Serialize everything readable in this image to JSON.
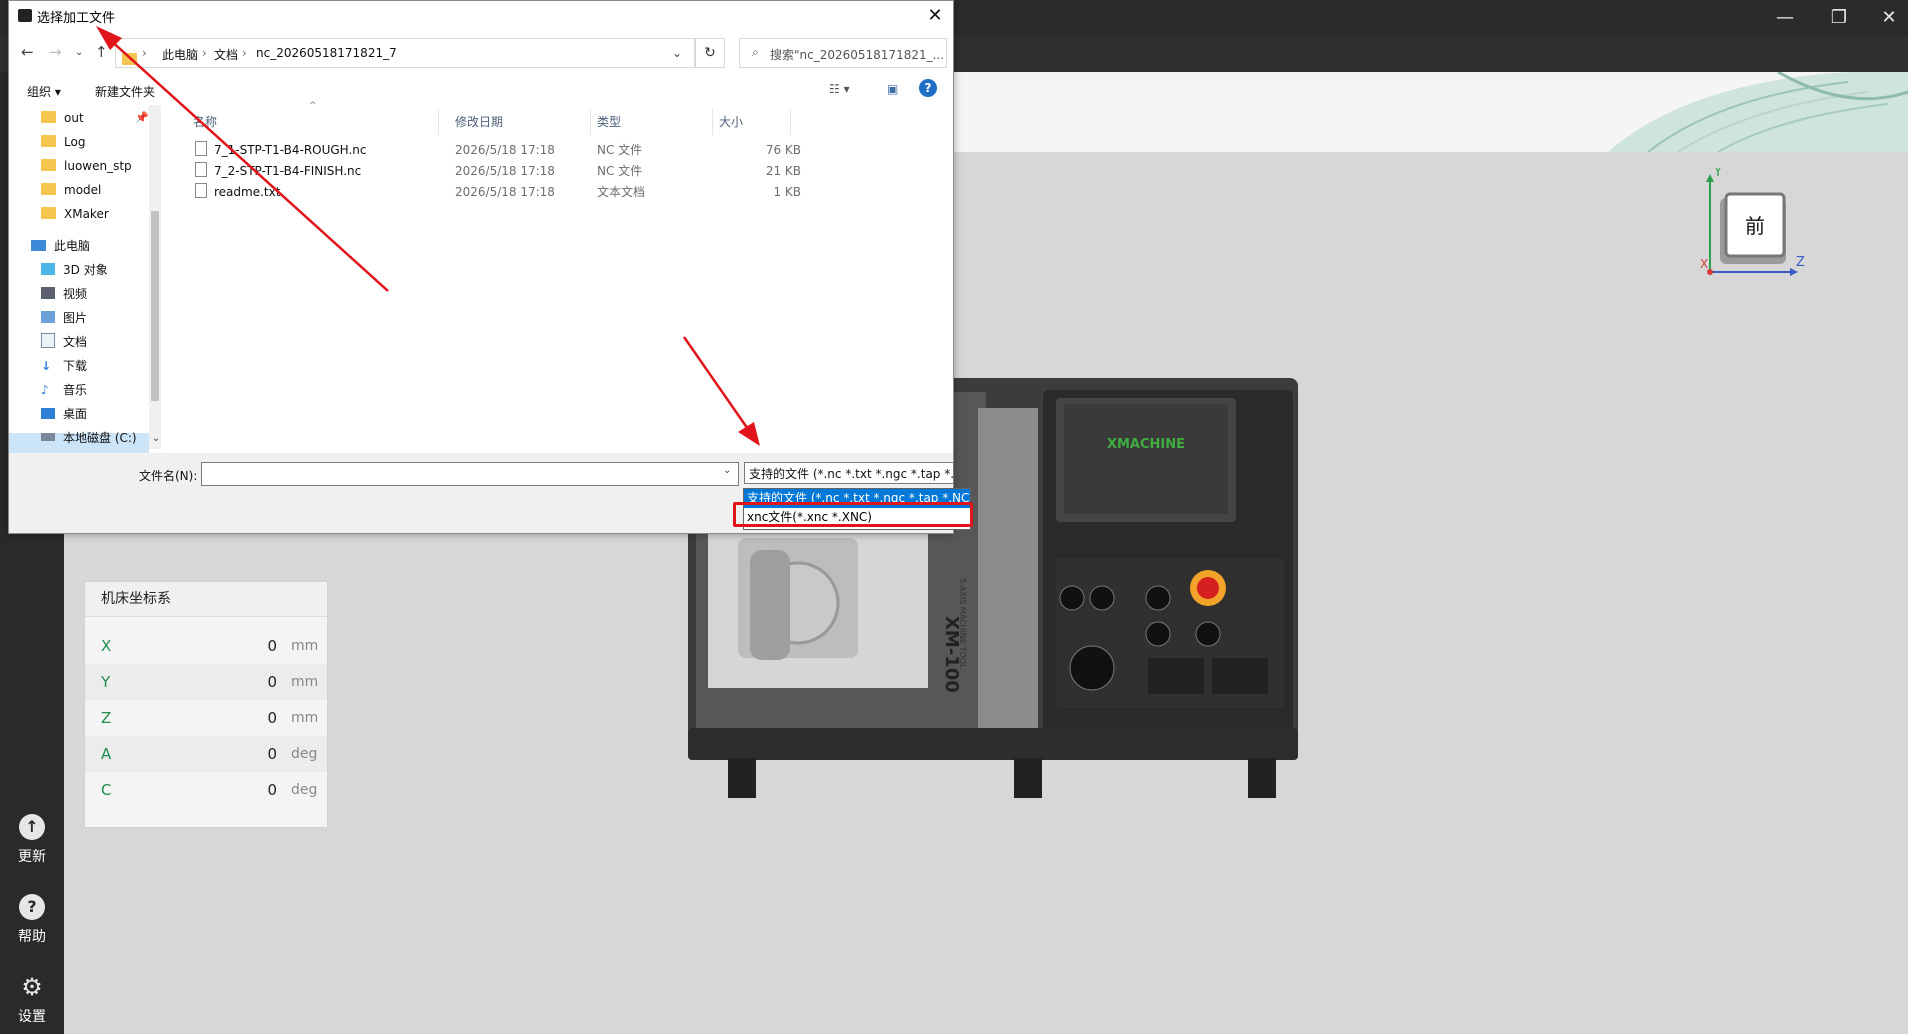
{
  "app": {
    "sidebar": [
      {
        "icon": "upload-icon",
        "label": "更新"
      },
      {
        "icon": "help-icon",
        "label": "帮助"
      },
      {
        "icon": "gear-icon",
        "label": "设置"
      }
    ],
    "window_controls": {
      "minimize": "—",
      "restore": "❐",
      "close": "✕"
    }
  },
  "coords": {
    "title": "机床坐标系",
    "rows": [
      {
        "axis": "X",
        "value": "0",
        "unit": "mm"
      },
      {
        "axis": "Y",
        "value": "0",
        "unit": "mm"
      },
      {
        "axis": "Z",
        "value": "0",
        "unit": "mm"
      },
      {
        "axis": "A",
        "value": "0",
        "unit": "deg"
      },
      {
        "axis": "C",
        "value": "0",
        "unit": "deg"
      }
    ]
  },
  "viewcube": {
    "face": "前",
    "axis_y": "Y",
    "axis_x": "X",
    "axis_z": "Z"
  },
  "machine": {
    "screen_brand": "XMACHINE",
    "side_label": "5-AXIS MACHINE TOOL",
    "model": "XM-100",
    "estop": "STOP"
  },
  "dialog": {
    "title": "选择加工文件",
    "breadcrumb": [
      "此电脑",
      "文档",
      "nc_20260518171821_7"
    ],
    "search_placeholder": "搜索\"nc_20260518171821_...",
    "toolbar": {
      "organize": "组织 ▾",
      "new_folder": "新建文件夹"
    },
    "tree": [
      {
        "label": "out",
        "type": "folder"
      },
      {
        "label": "Log",
        "type": "folder"
      },
      {
        "label": "luowen_stp",
        "type": "folder"
      },
      {
        "label": "model",
        "type": "folder"
      },
      {
        "label": "XMaker",
        "type": "folder"
      },
      {
        "label": "此电脑",
        "type": "pc"
      },
      {
        "label": "3D 对象",
        "type": "3d"
      },
      {
        "label": "视频",
        "type": "video"
      },
      {
        "label": "图片",
        "type": "picture"
      },
      {
        "label": "文档",
        "type": "doc"
      },
      {
        "label": "下载",
        "type": "download"
      },
      {
        "label": "音乐",
        "type": "music"
      },
      {
        "label": "桌面",
        "type": "desktop"
      },
      {
        "label": "本地磁盘 (C:)",
        "type": "drive"
      }
    ],
    "columns": [
      "名称",
      "修改日期",
      "类型",
      "大小"
    ],
    "files": [
      {
        "name": "7_1-STP-T1-B4-ROUGH.nc",
        "date": "2026/5/18 17:18",
        "type": "NC 文件",
        "size": "76 KB"
      },
      {
        "name": "7_2-STP-T1-B4-FINISH.nc",
        "date": "2026/5/18 17:18",
        "type": "NC 文件",
        "size": "21 KB"
      },
      {
        "name": "readme.txt",
        "date": "2026/5/18 17:18",
        "type": "文本文档",
        "size": "1 KB"
      }
    ],
    "filename_label": "文件名(N):",
    "filename_value": "",
    "filter_selected": "支持的文件 (*.nc *.txt *.ngc *.tap *.NC)",
    "filter_options": [
      "支持的文件 (*.nc *.txt *.ngc *.tap *.NC)",
      "xnc文件(*.xnc *.XNC)"
    ]
  },
  "colors": {
    "accent": "#1f8c4e",
    "selection": "#0078d7",
    "annotation": "#e0141a"
  }
}
